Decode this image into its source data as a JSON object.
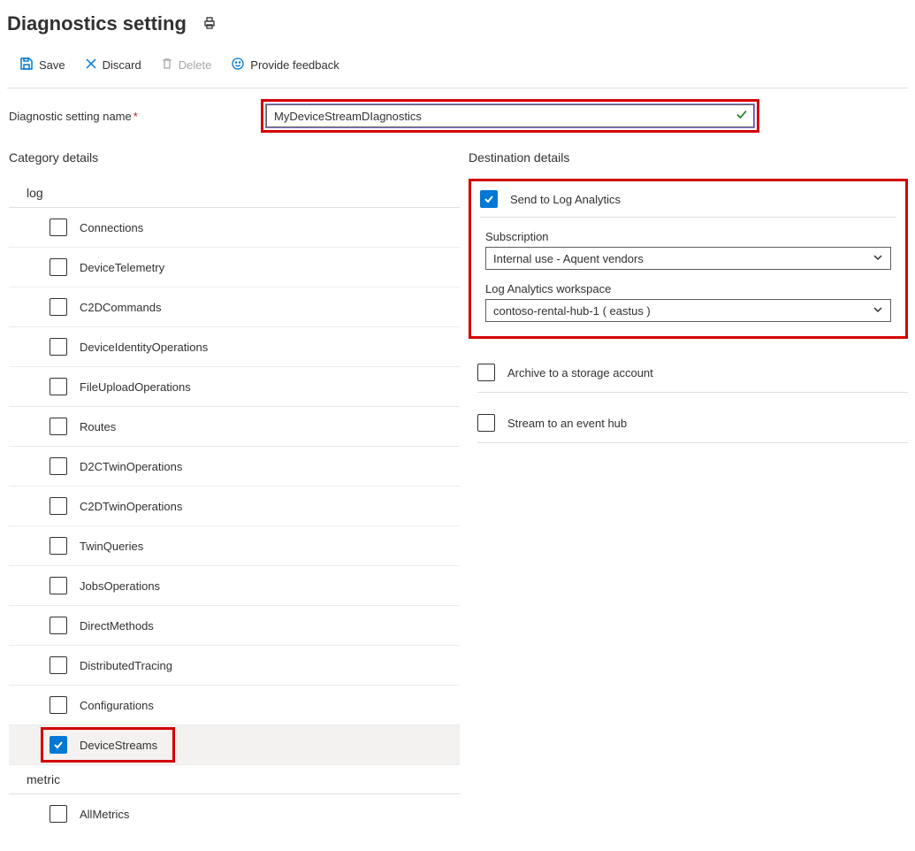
{
  "header": {
    "title": "Diagnostics setting"
  },
  "toolbar": {
    "save": "Save",
    "discard": "Discard",
    "delete": "Delete",
    "feedback": "Provide feedback"
  },
  "name": {
    "label": "Diagnostic setting name",
    "value": "MyDeviceStreamDIagnostics"
  },
  "category": {
    "heading": "Category details",
    "log_group": "log",
    "metric_group": "metric",
    "items": [
      {
        "label": "Connections",
        "checked": false
      },
      {
        "label": "DeviceTelemetry",
        "checked": false
      },
      {
        "label": "C2DCommands",
        "checked": false
      },
      {
        "label": "DeviceIdentityOperations",
        "checked": false
      },
      {
        "label": "FileUploadOperations",
        "checked": false
      },
      {
        "label": "Routes",
        "checked": false
      },
      {
        "label": "D2CTwinOperations",
        "checked": false
      },
      {
        "label": "C2DTwinOperations",
        "checked": false
      },
      {
        "label": "TwinQueries",
        "checked": false
      },
      {
        "label": "JobsOperations",
        "checked": false
      },
      {
        "label": "DirectMethods",
        "checked": false
      },
      {
        "label": "DistributedTracing",
        "checked": false
      },
      {
        "label": "Configurations",
        "checked": false
      },
      {
        "label": "DeviceStreams",
        "checked": true
      }
    ],
    "metrics": [
      {
        "label": "AllMetrics",
        "checked": false
      }
    ]
  },
  "destination": {
    "heading": "Destination details",
    "log_analytics": {
      "label": "Send to Log Analytics",
      "checked": true,
      "subscription_label": "Subscription",
      "subscription_value": "Internal use - Aquent vendors",
      "workspace_label": "Log Analytics workspace",
      "workspace_value": "contoso-rental-hub-1 ( eastus )"
    },
    "storage": {
      "label": "Archive to a storage account",
      "checked": false
    },
    "eventhub": {
      "label": "Stream to an event hub",
      "checked": false
    }
  }
}
